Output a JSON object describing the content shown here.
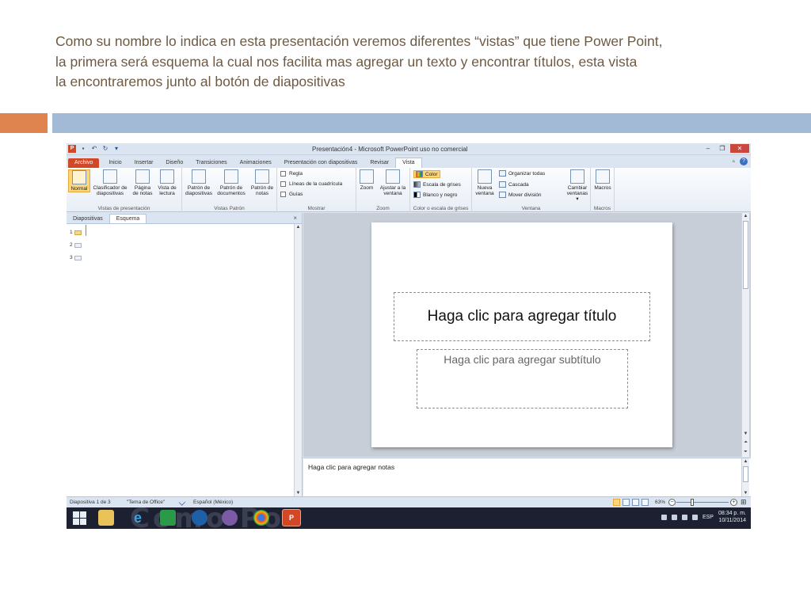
{
  "caption": {
    "line1": "Como su nombre lo indica en esta presentación veremos diferentes “vistas” que tiene Power Point,",
    "line2": "la primera será esquema la cual nos facilita mas agregar un texto y encontrar títulos, esta vista",
    "line3": "la encontraremos junto al botón de diapositivas"
  },
  "window": {
    "title": "Presentación4 - Microsoft PowerPoint uso no comercial",
    "qat_icon": "P"
  },
  "tabs": [
    {
      "label": "Archivo"
    },
    {
      "label": "Inicio"
    },
    {
      "label": "Insertar"
    },
    {
      "label": "Diseño"
    },
    {
      "label": "Transiciones"
    },
    {
      "label": "Animaciones"
    },
    {
      "label": "Presentación con diapositivas"
    },
    {
      "label": "Revisar"
    },
    {
      "label": "Vista"
    }
  ],
  "ribbon": {
    "vistas": {
      "label": "Vistas de presentación",
      "normal": "Normal",
      "clasificador": "Clasificador de diapositivas",
      "pagina": "Página de notas",
      "lectura": "Vista de lectura"
    },
    "patron": {
      "label": "Vistas Patrón",
      "diapositivas": "Patrón de diapositivas",
      "documentos": "Patrón de documentos",
      "notas": "Patrón de notas"
    },
    "mostrar": {
      "label": "Mostrar",
      "regla": "Regla",
      "lineas": "Líneas de la cuadrícula",
      "guias": "Guías"
    },
    "zoom": {
      "label": "Zoom",
      "zoom": "Zoom",
      "ajustar": "Ajustar a la ventana"
    },
    "color": {
      "label": "Color o escala de grises",
      "color": "Color",
      "grises": "Escala de grises",
      "bn": "Blanco y negro"
    },
    "ventana": {
      "label": "Ventana",
      "nueva": "Nueva ventana",
      "organizar": "Organizar todas",
      "cascada": "Cascada",
      "mover": "Mover división",
      "cambiar": "Cambiar ventanas ▾"
    },
    "macros": {
      "label": "Macros",
      "macros": "Macros"
    }
  },
  "leftpane": {
    "tab_diapositivas": "Diapositivas",
    "tab_esquema": "Esquema",
    "close": "×",
    "items": [
      "1",
      "2",
      "3"
    ]
  },
  "slide": {
    "title_placeholder": "Haga clic para agregar título",
    "subtitle_placeholder": "Haga clic para agregar subtítulo"
  },
  "notes": {
    "placeholder": "Haga clic para agregar notas"
  },
  "statusbar": {
    "slide_count": "Diapositiva 1 de 3",
    "theme": "\"Tema de Office\"",
    "language": "Español (México)",
    "zoom": "63%",
    "zoom_fraction": 0.63
  },
  "taskbar": {
    "watermark": "Como Po",
    "lang": "ESP",
    "time": "08:34 p. m.",
    "date": "10/11/2014"
  }
}
